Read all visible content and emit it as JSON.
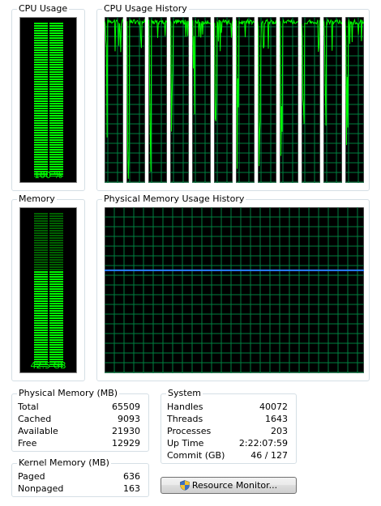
{
  "cpu_usage": {
    "title": "CPU Usage",
    "value_label": "100 %",
    "percent": 100
  },
  "cpu_history": {
    "title": "CPU Usage History",
    "core_count": 12
  },
  "memory": {
    "title": "Memory",
    "value_label": "42.5 GB",
    "fraction_used": 0.62
  },
  "memory_history": {
    "title": "Physical Memory Usage History",
    "level_fraction": 0.62
  },
  "physical_memory": {
    "title": "Physical Memory (MB)",
    "rows": [
      {
        "label": "Total",
        "value": "65509"
      },
      {
        "label": "Cached",
        "value": "9093"
      },
      {
        "label": "Available",
        "value": "21930"
      },
      {
        "label": "Free",
        "value": "12929"
      }
    ]
  },
  "kernel_memory": {
    "title": "Kernel Memory (MB)",
    "rows": [
      {
        "label": "Paged",
        "value": "636"
      },
      {
        "label": "Nonpaged",
        "value": "163"
      }
    ]
  },
  "system": {
    "title": "System",
    "rows": [
      {
        "label": "Handles",
        "value": "40072"
      },
      {
        "label": "Threads",
        "value": "1643"
      },
      {
        "label": "Processes",
        "value": "203"
      },
      {
        "label": "Up Time",
        "value": "2:22:07:59"
      },
      {
        "label": "Commit (GB)",
        "value": "46 / 127"
      }
    ]
  },
  "resource_monitor_button": {
    "label": "Resource Monitor...",
    "icon": "uac-shield-icon"
  },
  "colors": {
    "meter_green": "#00ff00",
    "grid_green": "#008040",
    "memory_line": "#2a7fff",
    "panel_bg": "#000000"
  }
}
